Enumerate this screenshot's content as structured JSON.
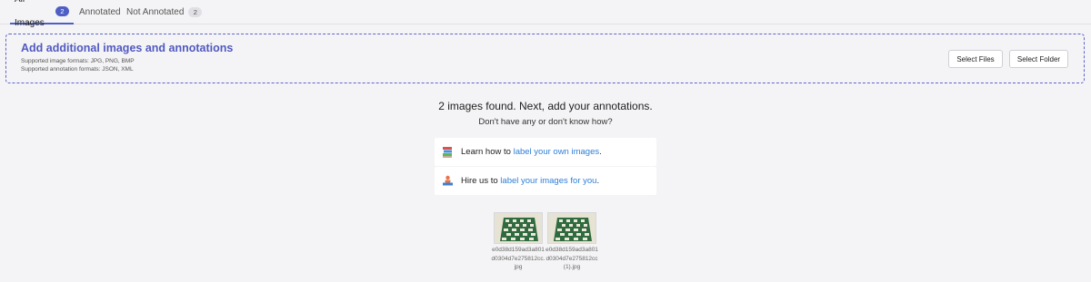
{
  "tabs": [
    {
      "label": "All Images",
      "count": "2"
    },
    {
      "label": "Annotated",
      "count": ""
    },
    {
      "label": "Not Annotated",
      "count": "2"
    }
  ],
  "dropzone": {
    "title": "Add additional images and annotations",
    "image_formats": "Supported image formats: JPG, PNG, BMP",
    "annotation_formats": "Supported annotation formats: JSON, XML",
    "select_files_label": "Select Files",
    "select_folder_label": "Select Folder"
  },
  "status": {
    "headline": "2 images found. Next, add your annotations.",
    "subline": "Don't have any or don't know how?"
  },
  "help_cards": [
    {
      "prefix": "Learn how to ",
      "link": "label your own images",
      "suffix": ".",
      "icon": "books-icon"
    },
    {
      "prefix": "Hire us to ",
      "link": "label your images for you",
      "suffix": ".",
      "icon": "person-at-desk-icon"
    }
  ],
  "images": [
    {
      "filename": "e0d38d159ad3a801d0304d7e275812cc.jpg"
    },
    {
      "filename": "e0d38d159ad3a801d0304d7e275812cc (1).jpg"
    }
  ],
  "colors": {
    "accent": "#4f5ec4",
    "link": "#2f7fd6",
    "dropzone_border": "#5f64c8"
  }
}
